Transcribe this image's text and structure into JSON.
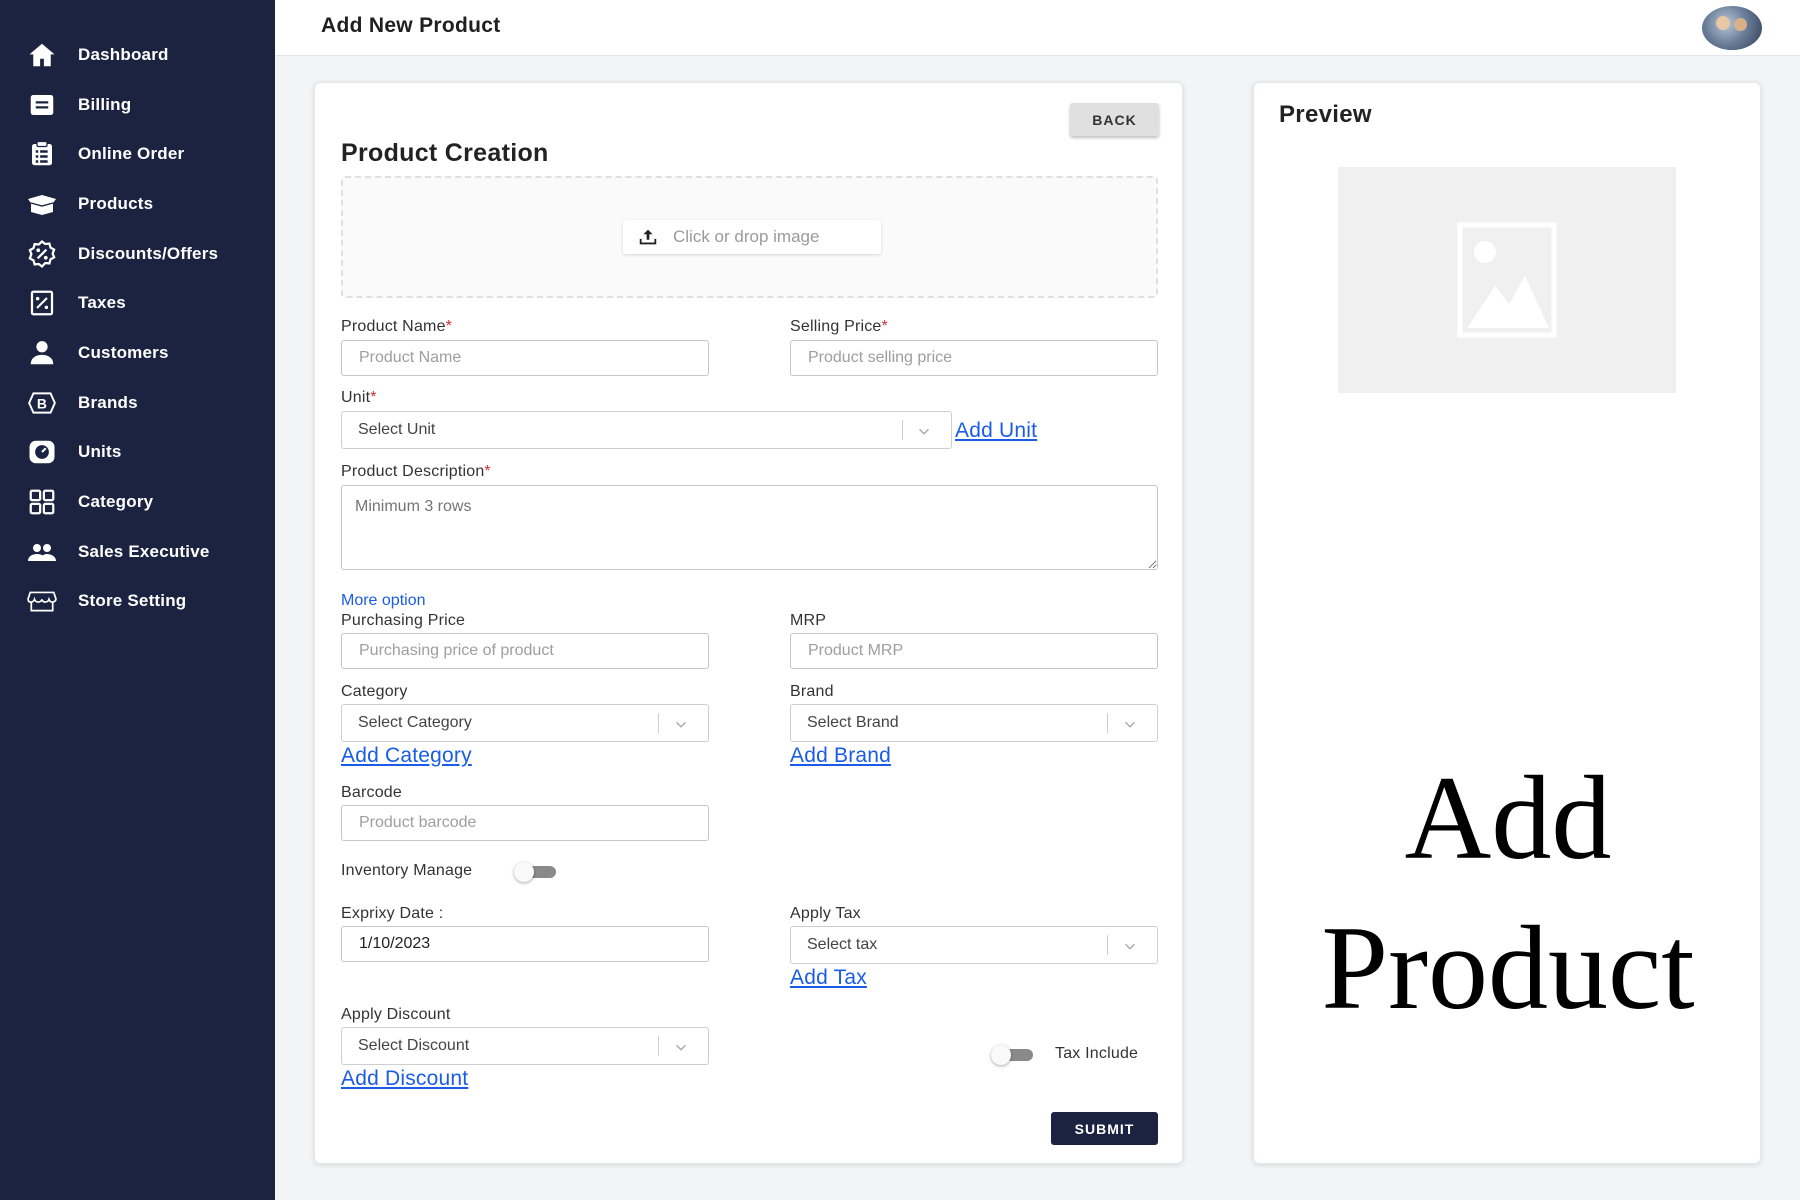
{
  "sidebar": {
    "items": [
      {
        "label": "Dashboard",
        "icon": "home-icon"
      },
      {
        "label": "Billing",
        "icon": "billing-icon"
      },
      {
        "label": "Online Order",
        "icon": "order-list-icon"
      },
      {
        "label": "Products",
        "icon": "box-icon"
      },
      {
        "label": "Discounts/Offers",
        "icon": "discount-badge-icon"
      },
      {
        "label": "Taxes",
        "icon": "tax-receipt-icon"
      },
      {
        "label": "Customers",
        "icon": "person-icon"
      },
      {
        "label": "Brands",
        "icon": "brand-b-icon"
      },
      {
        "label": "Units",
        "icon": "scale-icon"
      },
      {
        "label": "Category",
        "icon": "grid-icon"
      },
      {
        "label": "Sales Executive",
        "icon": "people-icon"
      },
      {
        "label": "Store Setting",
        "icon": "store-icon"
      }
    ]
  },
  "header": {
    "title": "Add New Product"
  },
  "form": {
    "back_label": "BACK",
    "title": "Product Creation",
    "upload_label": "Click or drop image",
    "product_name": {
      "label": "Product Name",
      "required": "*",
      "placeholder": "Product Name"
    },
    "selling_price": {
      "label": "Selling Price",
      "required": "*",
      "placeholder": "Product selling price"
    },
    "unit": {
      "label": "Unit",
      "required": "*",
      "placeholder": "Select Unit",
      "add_link": "Add Unit"
    },
    "description": {
      "label": "Product Description",
      "required": "*",
      "placeholder": "Minimum 3 rows"
    },
    "more_option": "More option",
    "purchasing_price": {
      "label": "Purchasing Price",
      "placeholder": "Purchasing price of product"
    },
    "mrp": {
      "label": "MRP",
      "placeholder": "Product MRP"
    },
    "category": {
      "label": "Category",
      "placeholder": "Select Category",
      "add_link": "Add Category"
    },
    "brand": {
      "label": "Brand",
      "placeholder": "Select Brand",
      "add_link": "Add Brand"
    },
    "barcode": {
      "label": "Barcode",
      "placeholder": "Product barcode"
    },
    "inventory_manage": {
      "label": "Inventory Manage",
      "on": false
    },
    "expiry_date": {
      "label": "Exprixy Date :",
      "value": "1/10/2023"
    },
    "apply_tax": {
      "label": "Apply Tax",
      "placeholder": "Select tax",
      "add_link": "Add Tax"
    },
    "apply_discount": {
      "label": "Apply Discount",
      "placeholder": "Select Discount",
      "add_link": "Add Discount"
    },
    "tax_include": {
      "label": "Tax Include",
      "on": false
    },
    "submit_label": "SUBMIT"
  },
  "preview": {
    "title": "Preview",
    "watermark_line1": "Add",
    "watermark_line2": "Product"
  },
  "colors": {
    "sidebar_bg": "#1c2340",
    "link": "#1a5ce8",
    "required": "#d32f2f",
    "submit_bg": "#1c2340"
  }
}
